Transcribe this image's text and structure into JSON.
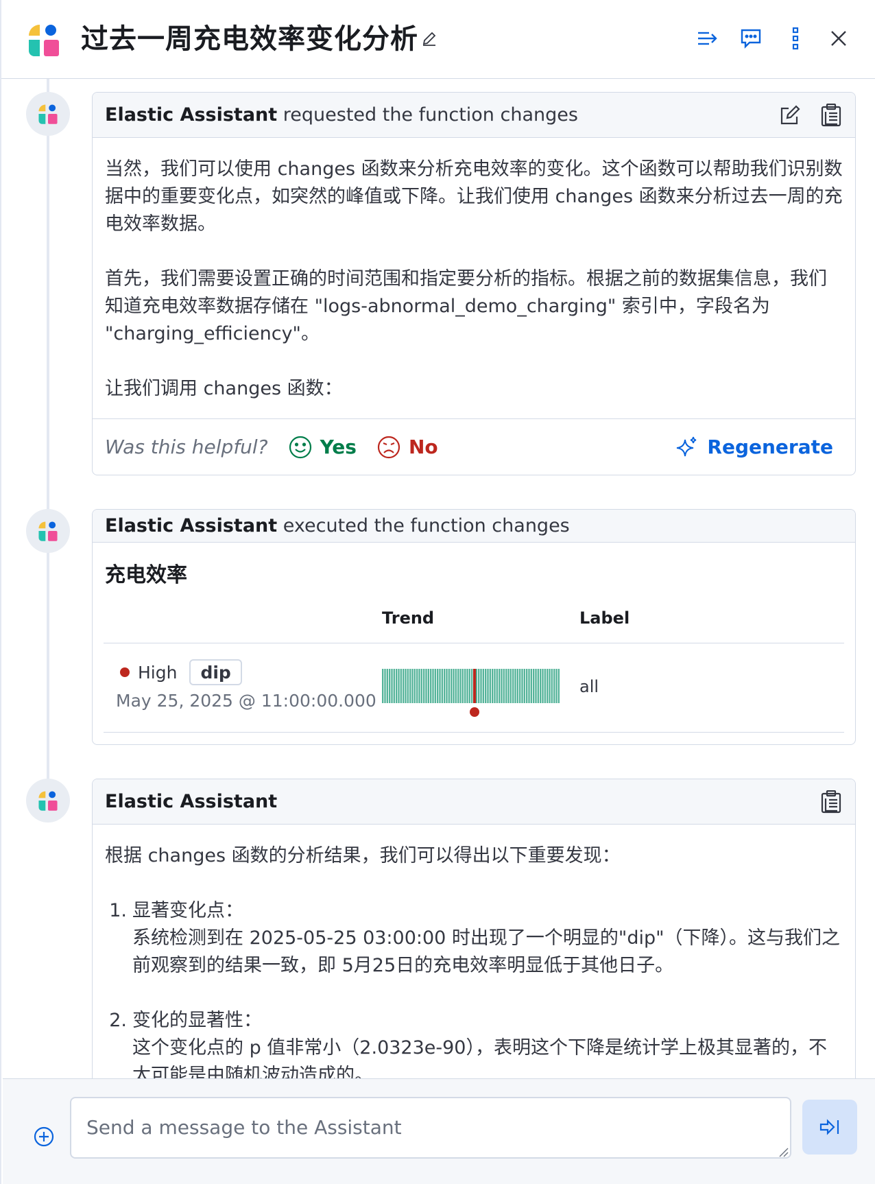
{
  "header": {
    "title": "过去一周充电效率变化分析",
    "icons": [
      "edit-title-icon",
      "context-icon",
      "chat-icon",
      "more-icon",
      "close-icon"
    ]
  },
  "messages": [
    {
      "head_bold": "Elastic Assistant",
      "head_rest": " requested the function changes",
      "paragraphs": [
        "当然，我们可以使用 changes 函数来分析充电效率的变化。这个函数可以帮助我们识别数据中的重要变化点，如突然的峰值或下降。让我们使用 changes 函数来分析过去一周的充电效率数据。",
        "首先，我们需要设置正确的时间范围和指定要分析的指标。根据之前的数据集信息，我们知道充电效率数据存储在 \"logs-abnormal_demo_charging\" 索引中，字段名为 \"charging_efficiency\"。",
        "让我们调用 changes 函数："
      ],
      "feedback": {
        "question": "Was this helpful?",
        "yes": "Yes",
        "no": "No",
        "regenerate": "Regenerate"
      }
    },
    {
      "head_bold": "Elastic Assistant",
      "head_rest": " executed the function changes",
      "metric_title": "充电效率",
      "columns": {
        "trend": "Trend",
        "label": "Label"
      },
      "row": {
        "severity": "High",
        "type": "dip",
        "timestamp": "May 25, 2025 @ 11:00:00.000",
        "label": "all"
      }
    },
    {
      "head_bold": "Elastic Assistant",
      "intro": "根据 changes 函数的分析结果，我们可以得出以下重要发现：",
      "items": [
        {
          "num": "1.",
          "title": "显著变化点：",
          "text": "系统检测到在 2025-05-25 03:00:00 时出现了一个明显的\"dip\"（下降）。这与我们之前观察到的结果一致，即 5月25日的充电效率明显低于其他日子。"
        },
        {
          "num": "2.",
          "title": "变化的显著性：",
          "text": "这个变化点的 p 值非常小（2.0323e-90），表明这个下降是统计学上极其显著的，不太可能是由随机波动造成的。"
        }
      ]
    }
  ],
  "composer": {
    "placeholder": "Send a message to the Assistant"
  },
  "colors": {
    "accent": "#0b64dd",
    "success": "#007d4a",
    "danger": "#bd271e",
    "spark": "#54b399"
  }
}
